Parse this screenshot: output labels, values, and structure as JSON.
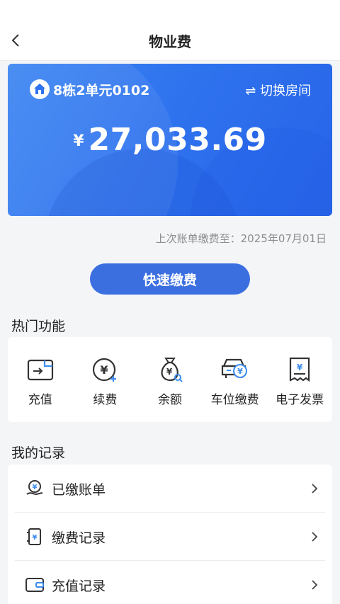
{
  "header": {
    "title": "物业费"
  },
  "account": {
    "room": "8栋2单元0102",
    "switch_label": "⇌ 切换房间",
    "currency": "¥",
    "amount": "27,033.69"
  },
  "last_payment": "上次账单缴费至：2025年07月01日",
  "pay_button": "快速缴费",
  "hot_functions": {
    "title": "热门功能",
    "items": [
      {
        "label": "充值",
        "icon": "wallet-icon"
      },
      {
        "label": "续费",
        "icon": "renew-coin-icon"
      },
      {
        "label": "余额",
        "icon": "money-bag-icon"
      },
      {
        "label": "车位缴费",
        "icon": "car-fee-icon"
      },
      {
        "label": "电子发票",
        "icon": "invoice-icon"
      }
    ]
  },
  "records": {
    "title": "我的记录",
    "items": [
      {
        "label": "已缴账单",
        "icon": "paid-bill-icon"
      },
      {
        "label": "缴费记录",
        "icon": "payment-record-icon"
      },
      {
        "label": "充值记录",
        "icon": "recharge-record-icon"
      }
    ]
  },
  "colors": {
    "accent": "#3b6fe0",
    "card": "#2f73ee",
    "icon_accent": "#3b8cf0"
  }
}
